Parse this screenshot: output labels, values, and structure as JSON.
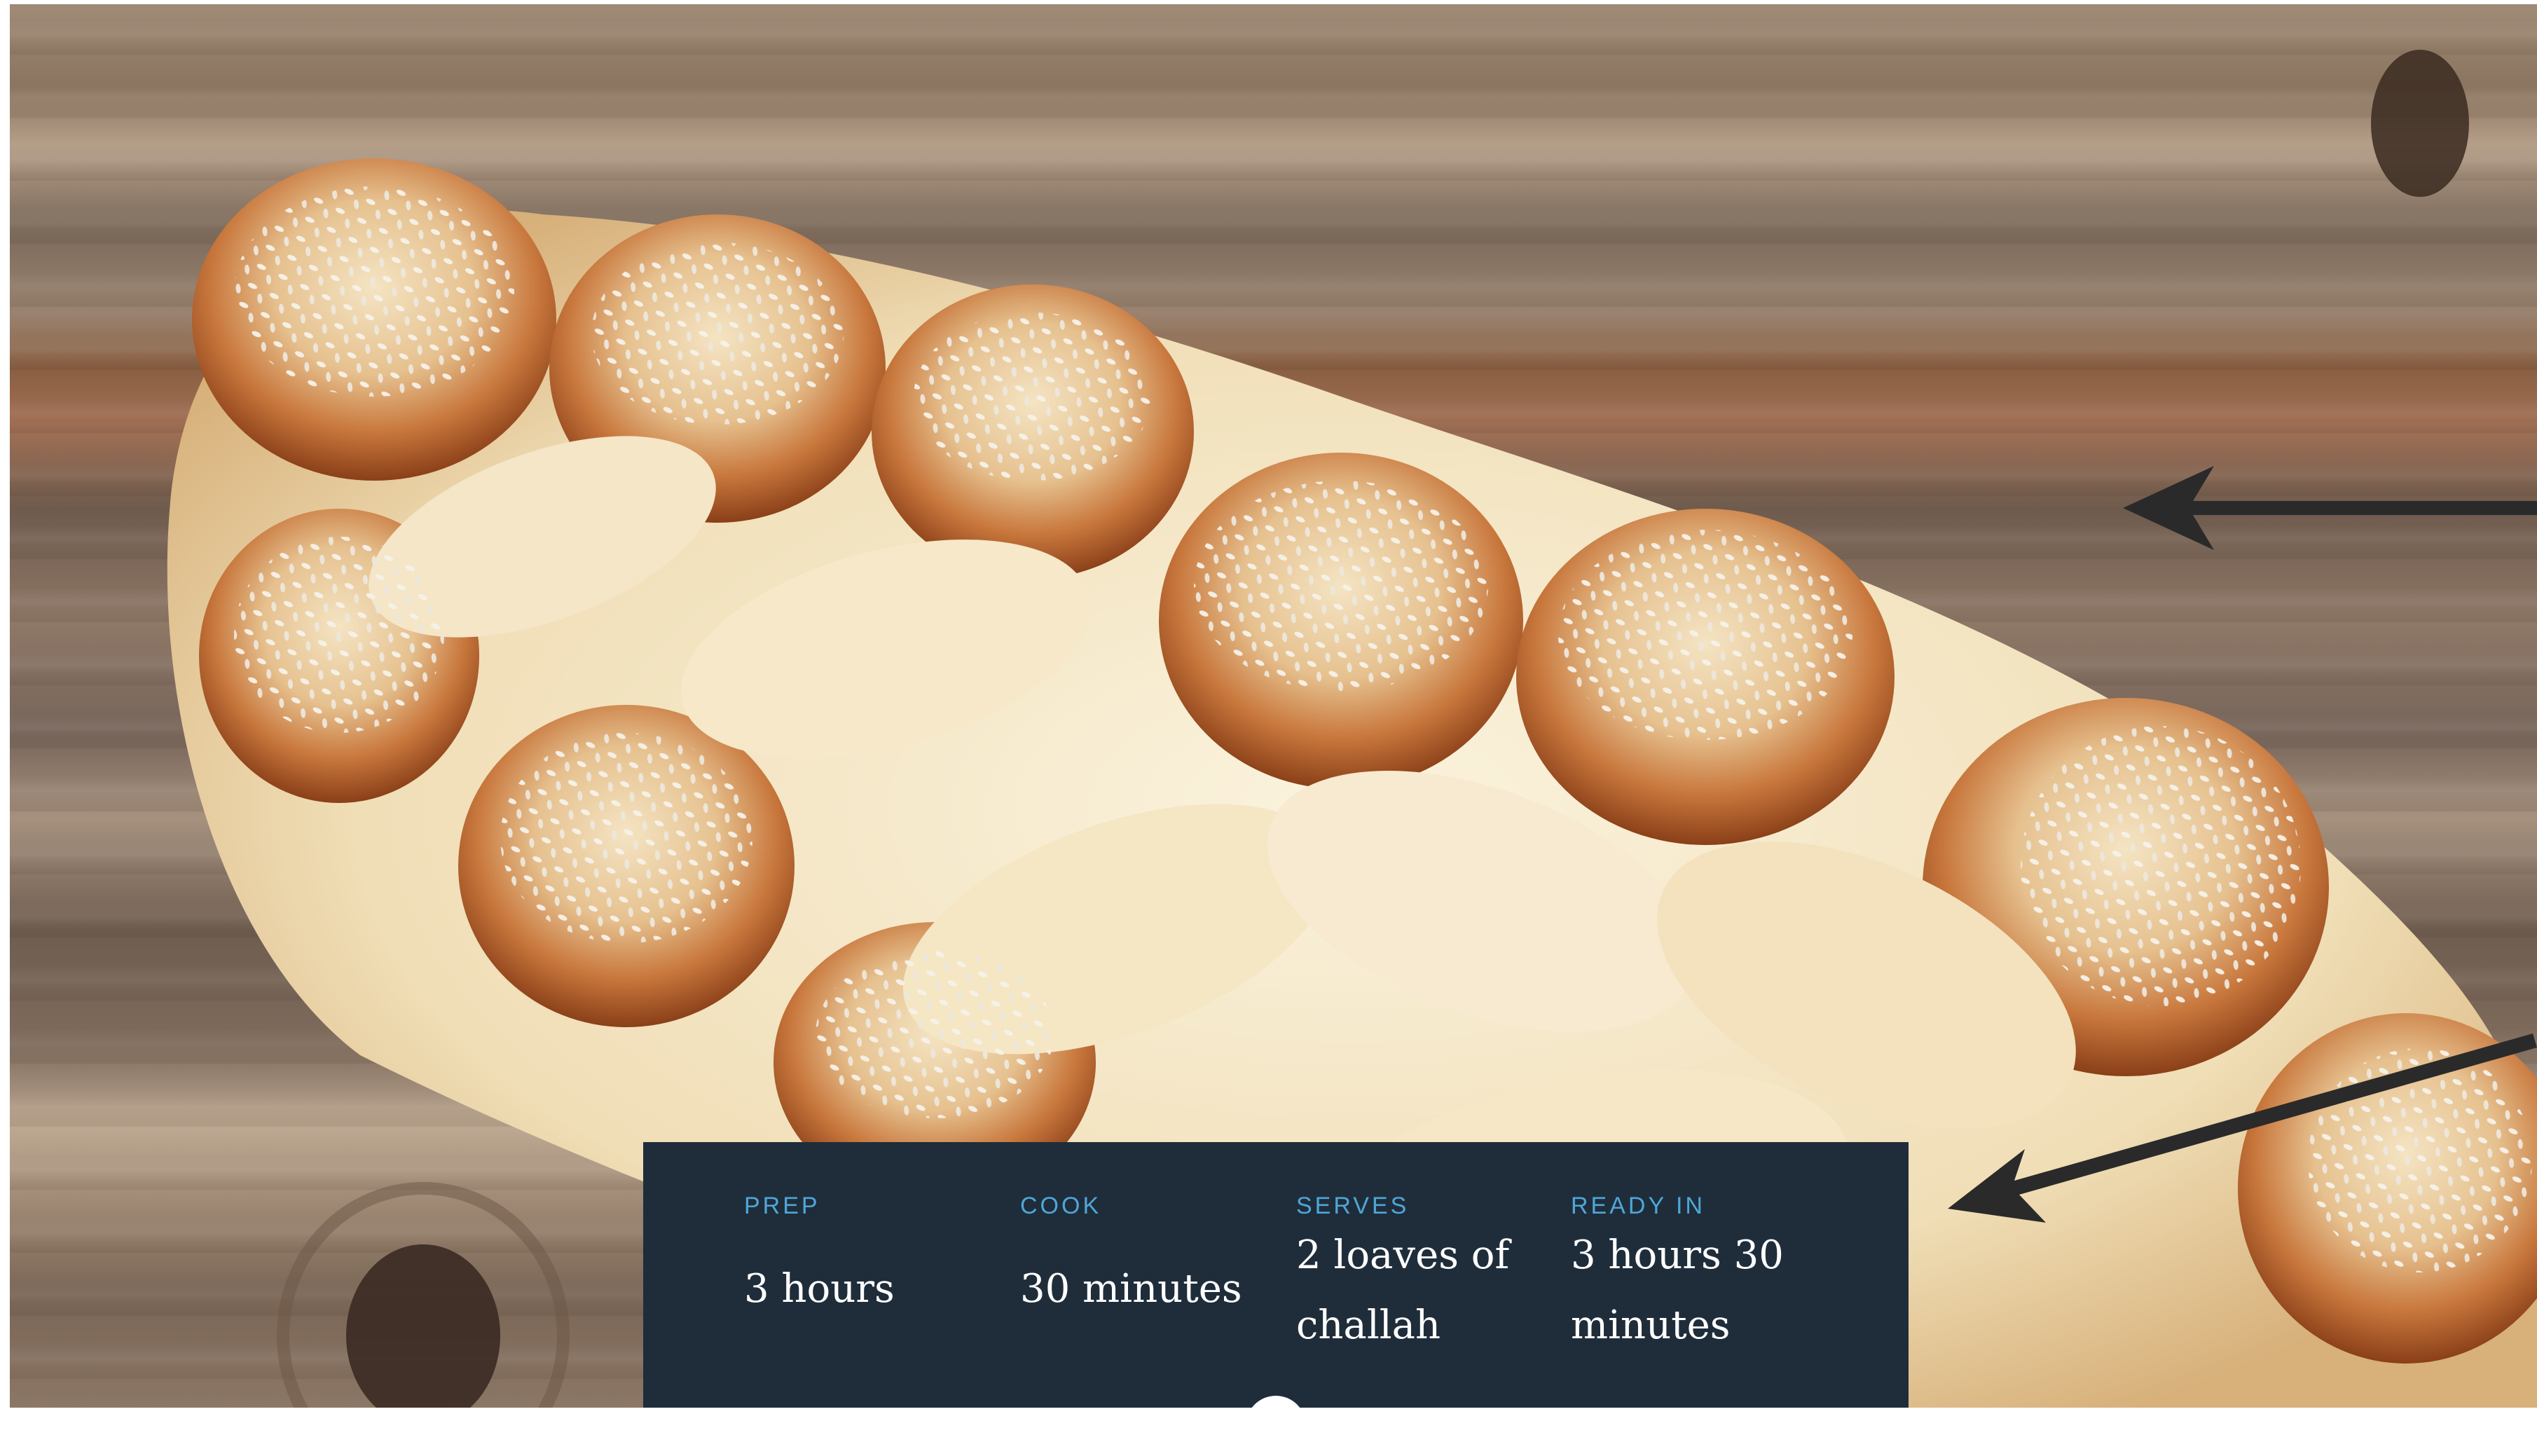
{
  "hero": {
    "image": "braided challah bread with sesame seeds on wooden board"
  },
  "recipe_info": {
    "items": [
      {
        "label": "PREP",
        "value": "3 hours"
      },
      {
        "label": "COOK",
        "value": "30 minutes"
      },
      {
        "label": "SERVES",
        "value": "2 loaves of challah"
      },
      {
        "label": "READY IN",
        "value": "3 hours 30 minutes"
      }
    ]
  },
  "colors": {
    "panel_bg": "#1f2d3b",
    "label_accent": "#4fa6d6",
    "value_text": "#ffffff",
    "arrow": "#2a2a2a"
  },
  "icons": [
    "arrow-left-icon",
    "arrow-down-left-icon"
  ]
}
